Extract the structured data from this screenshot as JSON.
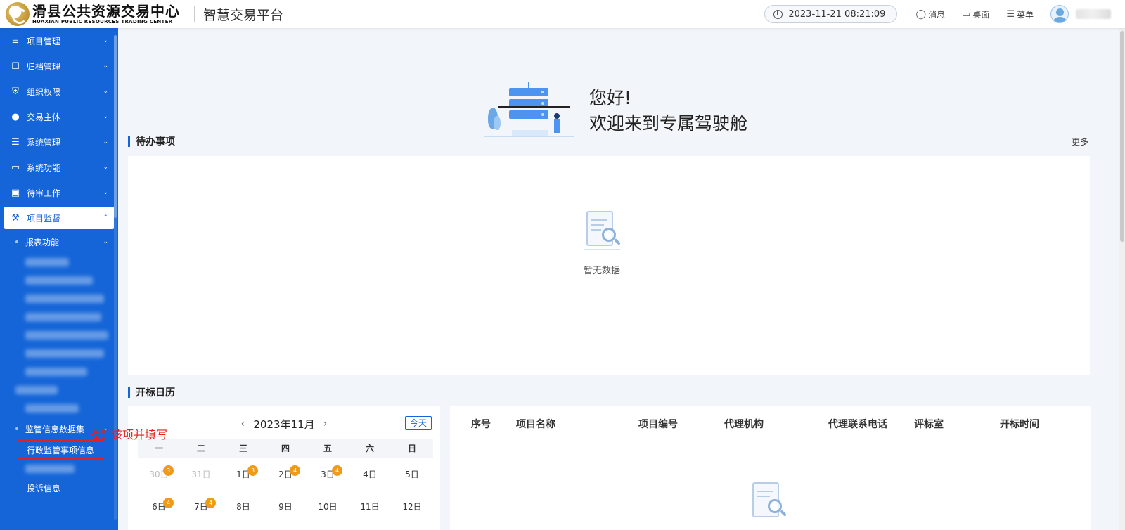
{
  "header": {
    "logo_cn": "滑县公共资源交易中心",
    "logo_en": "HUAXIAN PUBLIC RESOURCES TRADING CENTER",
    "platform_title": "智慧交易平台",
    "datetime": "2023-11-21 08:21:09",
    "messages_label": "消息",
    "desktop_label": "桌面",
    "menu_label": "菜单"
  },
  "sidebar": {
    "items": [
      {
        "label": "项目管理",
        "icon": "list-indent-icon"
      },
      {
        "label": "归档管理",
        "icon": "archive-icon"
      },
      {
        "label": "组织权限",
        "icon": "shield-icon"
      },
      {
        "label": "交易主体",
        "icon": "users-icon"
      },
      {
        "label": "系统管理",
        "icon": "checklist-icon"
      },
      {
        "label": "系统功能",
        "icon": "monitor-icon"
      },
      {
        "label": "待审工作",
        "icon": "calendar-icon"
      },
      {
        "label": "项目监督",
        "icon": "gavel-icon"
      }
    ],
    "report_func": "报表功能",
    "supervision_dataset": "监管信息数据集",
    "admin_supervision": "行政监管事项信息",
    "complaint_info": "投诉信息"
  },
  "welcome": {
    "hi": "您好!",
    "message": "欢迎来到专属驾驶舱"
  },
  "todo": {
    "title": "待办事项",
    "more": "更多",
    "empty": "暂无数据"
  },
  "calendar": {
    "section_title": "开标日历",
    "month": "2023年11月",
    "today": "今天",
    "weekdays": [
      "一",
      "二",
      "三",
      "四",
      "五",
      "六",
      "日"
    ],
    "rows": [
      [
        {
          "d": "30日",
          "muted": true,
          "badge": "3"
        },
        {
          "d": "31日",
          "muted": true
        },
        {
          "d": "1日",
          "badge": "3"
        },
        {
          "d": "2日",
          "badge": "4"
        },
        {
          "d": "3日",
          "badge": "4"
        },
        {
          "d": "4日"
        },
        {
          "d": "5日"
        }
      ],
      [
        {
          "d": "6日",
          "badge": "4"
        },
        {
          "d": "7日",
          "badge": "4"
        },
        {
          "d": "8日"
        },
        {
          "d": "9日"
        },
        {
          "d": "10日"
        },
        {
          "d": "11日"
        },
        {
          "d": "12日"
        }
      ]
    ]
  },
  "table": {
    "headers": [
      "序号",
      "项目名称",
      "项目编号",
      "代理机构",
      "代理联系电话",
      "评标室",
      "开标时间"
    ]
  },
  "annotation": "找到该项并填写",
  "colors": {
    "sidebar_bg": "#1565d8",
    "accent": "#1565d8",
    "badge": "#f09a1a",
    "annotation": "#e0211d"
  }
}
